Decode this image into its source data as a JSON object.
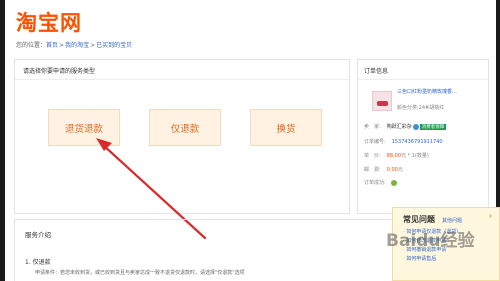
{
  "logo": "淘宝网",
  "breadcrumb": {
    "prefix": "您的位置：",
    "items": [
      "首页",
      "我的淘宝",
      "已买到的宝贝"
    ],
    "separator": ">"
  },
  "service_panel": {
    "heading": "请选择你要申请的服务类型",
    "buttons": [
      "退货退款",
      "仅退款",
      "换货"
    ]
  },
  "order_panel": {
    "heading": "订单信息",
    "product_name": "三色口红粉墨奶精玫瑰香…",
    "product_attr": "颜色分类:24#胡桃红",
    "seller_label": "卖　家:",
    "seller_name": "陶跃汇彩杂",
    "seller_badge": "消费者保障",
    "order_no_label": "订单编号:",
    "order_no": "1537436791911740",
    "price_label": "单　价:",
    "price": "88.00",
    "price_unit": "元 * 1(数量)",
    "shipping_label": "邮　费:",
    "shipping": "0.00",
    "shipping_unit": "元",
    "time_label": "订单成功:"
  },
  "intro": {
    "heading": "服务介绍",
    "section": "1. 仅退款",
    "condition": "申请条件：若您未收到货，或已收到货且与卖家达成一致不退货仅退款时，请选择\"仅退款\"选项"
  },
  "faq": {
    "title": "常见问题",
    "more": "其他问题",
    "close": "×",
    "items": [
      "如何申请仅退款（退货）",
      "如何修改退款申请",
      "如何撤销退款申请",
      "如何申请售后"
    ]
  },
  "watermark": "Baidu经验",
  "colors": {
    "brand": "#ff5000",
    "button_bg": "#fff2e2",
    "button_text": "#e06a20",
    "link": "#3366cc",
    "arrow": "#d92b2b"
  }
}
